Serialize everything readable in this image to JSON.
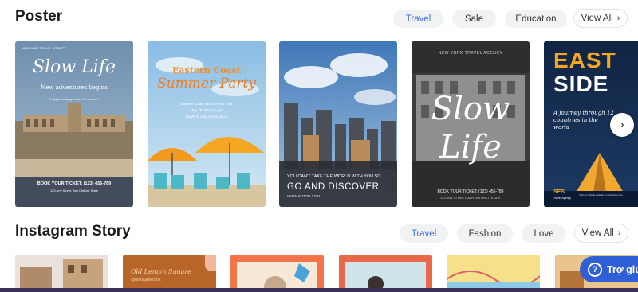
{
  "poster": {
    "title": "Poster",
    "filters": [
      "Travel",
      "Sale",
      "Education"
    ],
    "active_filter": "Travel",
    "view_all": "View All",
    "cards": [
      {
        "agency": "NEW YORK TRAVEL AGENCY",
        "headline": "Slow Life",
        "tagline": "New adventures begins",
        "small": "Enjoy the relaxing journey this summer!",
        "cta": "BOOK YOUR TICKET: (123) 456-789",
        "address": "123 Any Street, Any District, State"
      },
      {
        "headline_top": "Eastern Coast",
        "headline_main": "Summer Party",
        "line1": "Eastern Coast Beach, New York",
        "line2": "May 28, 2019 | 5 pm",
        "line3": "RSVP to rsvp at this place"
      },
      {
        "line1": "YOU CAN'T TAKE THE WORLD WITH YOU SO",
        "headline": "GO AND DISCOVER",
        "site": "WWW.FOTOR.COM"
      },
      {
        "agency": "NEW YORK TRAVEL AGENCY",
        "headline_1": "Slow",
        "headline_2": "Life",
        "cta": "BOOK YOUR TICKET: (123) 456-789",
        "address": "123 ANY STREET, ANY DISTRICT, STATE"
      },
      {
        "headline_1": "EAST",
        "headline_2": "SIDE",
        "subtitle": "A journey through 12 countries in the world",
        "brand": "SES",
        "brand_sub": "Travel Agency",
        "footer": "Visit our official website at www.fotor.com"
      }
    ]
  },
  "instagram": {
    "title": "Instagram Story",
    "filters": [
      "Travel",
      "Fashion",
      "Love"
    ],
    "active_filter": "Travel",
    "view_all": "View All",
    "cards": [
      {
        "label": ""
      },
      {
        "label": "Old Lemon Square",
        "handle": "@Mariajanecook"
      },
      {
        "label": ""
      },
      {
        "label": ""
      },
      {
        "label": ""
      },
      {
        "label": ""
      }
    ]
  },
  "help": {
    "label": "Trợ giú"
  },
  "colors": {
    "accent": "#3d6be0",
    "help_button": "#2f5fd6",
    "bottom_bar": "#3a2f57"
  }
}
